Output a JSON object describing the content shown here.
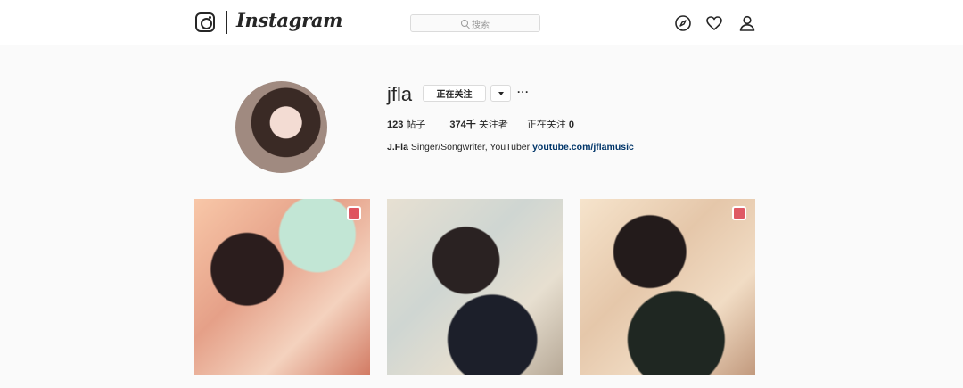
{
  "header": {
    "wordmark": "Instagram",
    "search_placeholder": "搜索",
    "nav_icons": [
      "compass-icon",
      "heart-icon",
      "person-icon"
    ]
  },
  "profile": {
    "username": "jfla",
    "follow_button": "正在关注",
    "more_label": "···",
    "stats": {
      "posts_count": "123",
      "posts_label": "帖子",
      "followers_count": "374千",
      "followers_label": "关注者",
      "following_label": "正在关注",
      "following_count": "0"
    },
    "bio": {
      "name": "J.Fla",
      "text": "Singer/Songwriter, YouTuber",
      "link": "youtube.com/jflamusic"
    }
  },
  "posts": [
    {
      "type": "photo"
    },
    {
      "type": "photo"
    },
    {
      "type": "photo"
    }
  ],
  "colors": {
    "background": "#fafafa",
    "link": "#003569",
    "border": "#dbdbdb"
  }
}
